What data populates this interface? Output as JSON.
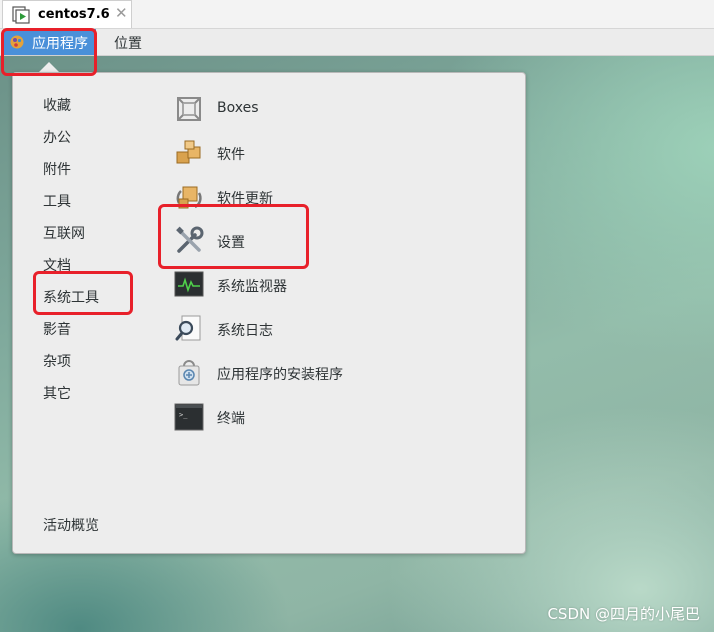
{
  "vm_tab": {
    "title": "centos7.6",
    "close_glyph": "✕"
  },
  "topbar": {
    "applications_label": "应用程序",
    "places_label": "位置"
  },
  "menu": {
    "categories": [
      "收藏",
      "办公",
      "附件",
      "工具",
      "互联网",
      "文档",
      "系统工具",
      "影音",
      "杂项",
      "其它"
    ],
    "activities_label": "活动概览",
    "items": [
      {
        "label": "Boxes",
        "icon": "boxes-icon"
      },
      {
        "label": "软件",
        "icon": "software-icon"
      },
      {
        "label": "软件更新",
        "icon": "software-update-icon"
      },
      {
        "label": "设置",
        "icon": "settings-tools-icon"
      },
      {
        "label": "系统监视器",
        "icon": "system-monitor-icon"
      },
      {
        "label": "系统日志",
        "icon": "system-log-icon"
      },
      {
        "label": "应用程序的安装程序",
        "icon": "app-installer-icon"
      },
      {
        "label": "终端",
        "icon": "terminal-icon"
      }
    ]
  },
  "highlight_color": "#e8202a",
  "accent_color": "#4a90d9",
  "watermark": "CSDN @四月的小尾巴"
}
